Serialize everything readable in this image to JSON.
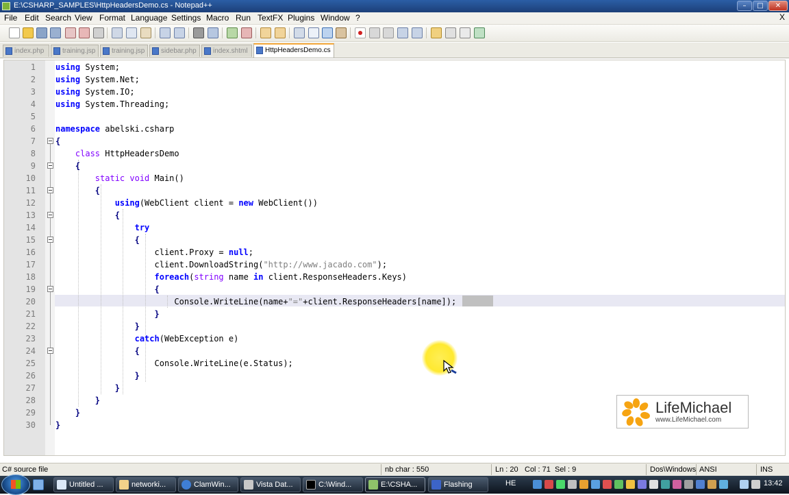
{
  "window": {
    "title": "E:\\CSHARP_SAMPLES\\HttpHeadersDemo.cs - Notepad++",
    "min": "–",
    "max": "□",
    "close": "✕"
  },
  "menu": {
    "items": [
      "File",
      "Edit",
      "Search",
      "View",
      "Format",
      "Language",
      "Settings",
      "Macro",
      "Run",
      "TextFX",
      "Plugins",
      "Window",
      "?"
    ],
    "close": "X"
  },
  "tabs": [
    {
      "label": "index.php"
    },
    {
      "label": "training.jsp"
    },
    {
      "label": "training.jsp"
    },
    {
      "label": "sidebar.php"
    },
    {
      "label": "index.shtml"
    },
    {
      "label": "HttpHeadersDemo.cs",
      "active": true
    }
  ],
  "editor": {
    "line_numbers": [
      "1",
      "2",
      "3",
      "4",
      "5",
      "6",
      "7",
      "8",
      "9",
      "10",
      "11",
      "12",
      "13",
      "14",
      "15",
      "16",
      "17",
      "18",
      "19",
      "20",
      "21",
      "22",
      "23",
      "24",
      "25",
      "26",
      "27",
      "28",
      "29",
      "30"
    ],
    "current_line": 20
  },
  "logo": {
    "name": "LifeMichael",
    "url": "www.LifeMichael.com"
  },
  "status": {
    "file_type": "C# source file",
    "nb_char": "nb char : 550",
    "ln": "Ln : 20",
    "col": "Col : 71",
    "sel": "Sel : 9",
    "eol": "Dos\\Windows",
    "encoding": "ANSI",
    "mode": "INS"
  },
  "taskbar": {
    "tasks": [
      {
        "label": "Untitled ..."
      },
      {
        "label": "networki..."
      },
      {
        "label": "ClamWin..."
      },
      {
        "label": "Vista Dat..."
      },
      {
        "label": "C:\\Wind..."
      },
      {
        "label": "E:\\CSHA...",
        "active": true
      },
      {
        "label": "Flashing"
      }
    ],
    "language": "HE",
    "clock": "13:42"
  },
  "colors": {
    "keyword": "#0000ff",
    "type": "#8000ff",
    "string": "#808080",
    "tab_active_accent": "#f4a83c"
  }
}
